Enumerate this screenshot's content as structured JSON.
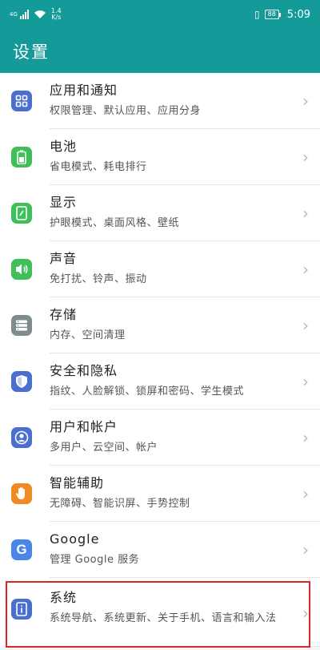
{
  "status_bar": {
    "signal_label": "4G",
    "net_speed_value": "1.4",
    "net_speed_unit": "K/s",
    "battery": "88",
    "time": "5:09"
  },
  "app_bar": {
    "title": "设置"
  },
  "items": [
    {
      "title": "应用和通知",
      "subtitle": "权限管理、默认应用、应用分身",
      "icon": "apps-grid-icon",
      "color": "#4a6fd1"
    },
    {
      "title": "电池",
      "subtitle": "省电模式、耗电排行",
      "icon": "battery-icon",
      "color": "#3fbf5a"
    },
    {
      "title": "显示",
      "subtitle": "护眼模式、桌面风格、壁纸",
      "icon": "display-icon",
      "color": "#3fbf5a"
    },
    {
      "title": "声音",
      "subtitle": "免打扰、铃声、振动",
      "icon": "speaker-icon",
      "color": "#3fbf5a"
    },
    {
      "title": "存储",
      "subtitle": "内存、空间清理",
      "icon": "storage-icon",
      "color": "#7f8c8d"
    },
    {
      "title": "安全和隐私",
      "subtitle": "指纹、人脸解锁、锁屏和密码、学生模式",
      "icon": "shield-icon",
      "color": "#4a6fd1"
    },
    {
      "title": "用户和帐户",
      "subtitle": "多用户、云空间、帐户",
      "icon": "user-icon",
      "color": "#4a6fd1"
    },
    {
      "title": "智能辅助",
      "subtitle": "无障碍、智能识屏、手势控制",
      "icon": "hand-icon",
      "color": "#f08a24"
    },
    {
      "title": "Google",
      "subtitle": "管理 Google 服务",
      "icon": "google-icon",
      "color": "#4a86e8"
    },
    {
      "title": "系统",
      "subtitle": "系统导航、系统更新、关于手机、语言和输入法",
      "icon": "info-icon",
      "color": "#4a6fd1"
    }
  ]
}
